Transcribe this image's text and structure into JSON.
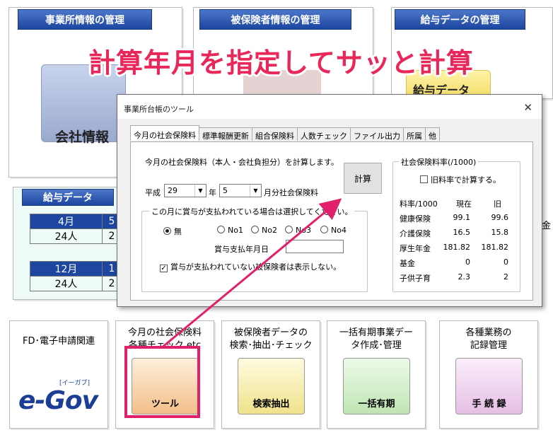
{
  "headline": "計算年月を指定してサッと計算",
  "top_panels": {
    "office": {
      "header": "事業所情報の管理",
      "icon_label": "会社情報"
    },
    "insured": {
      "header": "被保険者情報の管理"
    },
    "salary": {
      "header": "給与データの管理",
      "icon_label": "給与データ"
    }
  },
  "kyuyo": {
    "header": "給与データ",
    "block1": {
      "month": "4月",
      "next": "5",
      "count": "24人",
      "next_count": "2"
    },
    "block2": {
      "month": "12月",
      "next": "1",
      "count": "24人",
      "next_count": "2"
    }
  },
  "right_partial": "金",
  "dialog": {
    "title": "事業所台帳のツール",
    "close": "✕",
    "tabs": [
      "今月の社会保険料",
      "標準報酬更新",
      "組合保険料",
      "人数チェック",
      "ファイル出力",
      "所属",
      "他"
    ],
    "description": "今月の社会保険料（本人・会社負担分）を計算します。",
    "era": "平成",
    "year_value": "29",
    "year_unit": "年",
    "month_value": "5",
    "month_suffix": "月分社会保険料",
    "calc_button": "計算",
    "bonus_group": {
      "title": "この月に賞与が支払われている場合は選択してください。",
      "options": [
        "無",
        "No1",
        "No2",
        "No3",
        "No4"
      ],
      "selected": "無",
      "date_label": "賞与支払年月日",
      "date_value": "",
      "hide_check_label": "賞与が支払われていない被保険者は表示しない。",
      "hide_checked": true
    },
    "rates": {
      "title": "社会保険料率(/1000)",
      "old_rate_label": "旧料率で計算する。",
      "old_rate_checked": false,
      "columns": [
        "料率/1000",
        "現在",
        "旧"
      ],
      "rows": [
        {
          "name": "健康保険",
          "current": "99.1",
          "old": "99.6"
        },
        {
          "name": "介護保険",
          "current": "16.5",
          "old": "15.8"
        },
        {
          "name": "厚生年金",
          "current": "181.82",
          "old": "181.82"
        },
        {
          "name": "基金",
          "current": "0",
          "old": "0"
        },
        {
          "name": "子供子育",
          "current": "2.3",
          "old": "2"
        }
      ]
    }
  },
  "tiles": [
    {
      "title": "FD･電子申請関連",
      "icon_label": "e-Gov",
      "icon_sub": "[イーガブ]"
    },
    {
      "title": "今月の社会保険料\n各種チェック etc",
      "icon_label": "ツール"
    },
    {
      "title": "被保険者データの\n検索･抽出･チェック",
      "icon_label": "検索抽出"
    },
    {
      "title": "一括有期事業デー\nタ作成･管理",
      "icon_label": "一括有期"
    },
    {
      "title": "各種業務の\n記録管理",
      "icon_label": "手 続 録"
    }
  ],
  "colors": {
    "headline": "#e8285a",
    "header_blue": "#1c46a0",
    "highlight": "#e0206a"
  }
}
